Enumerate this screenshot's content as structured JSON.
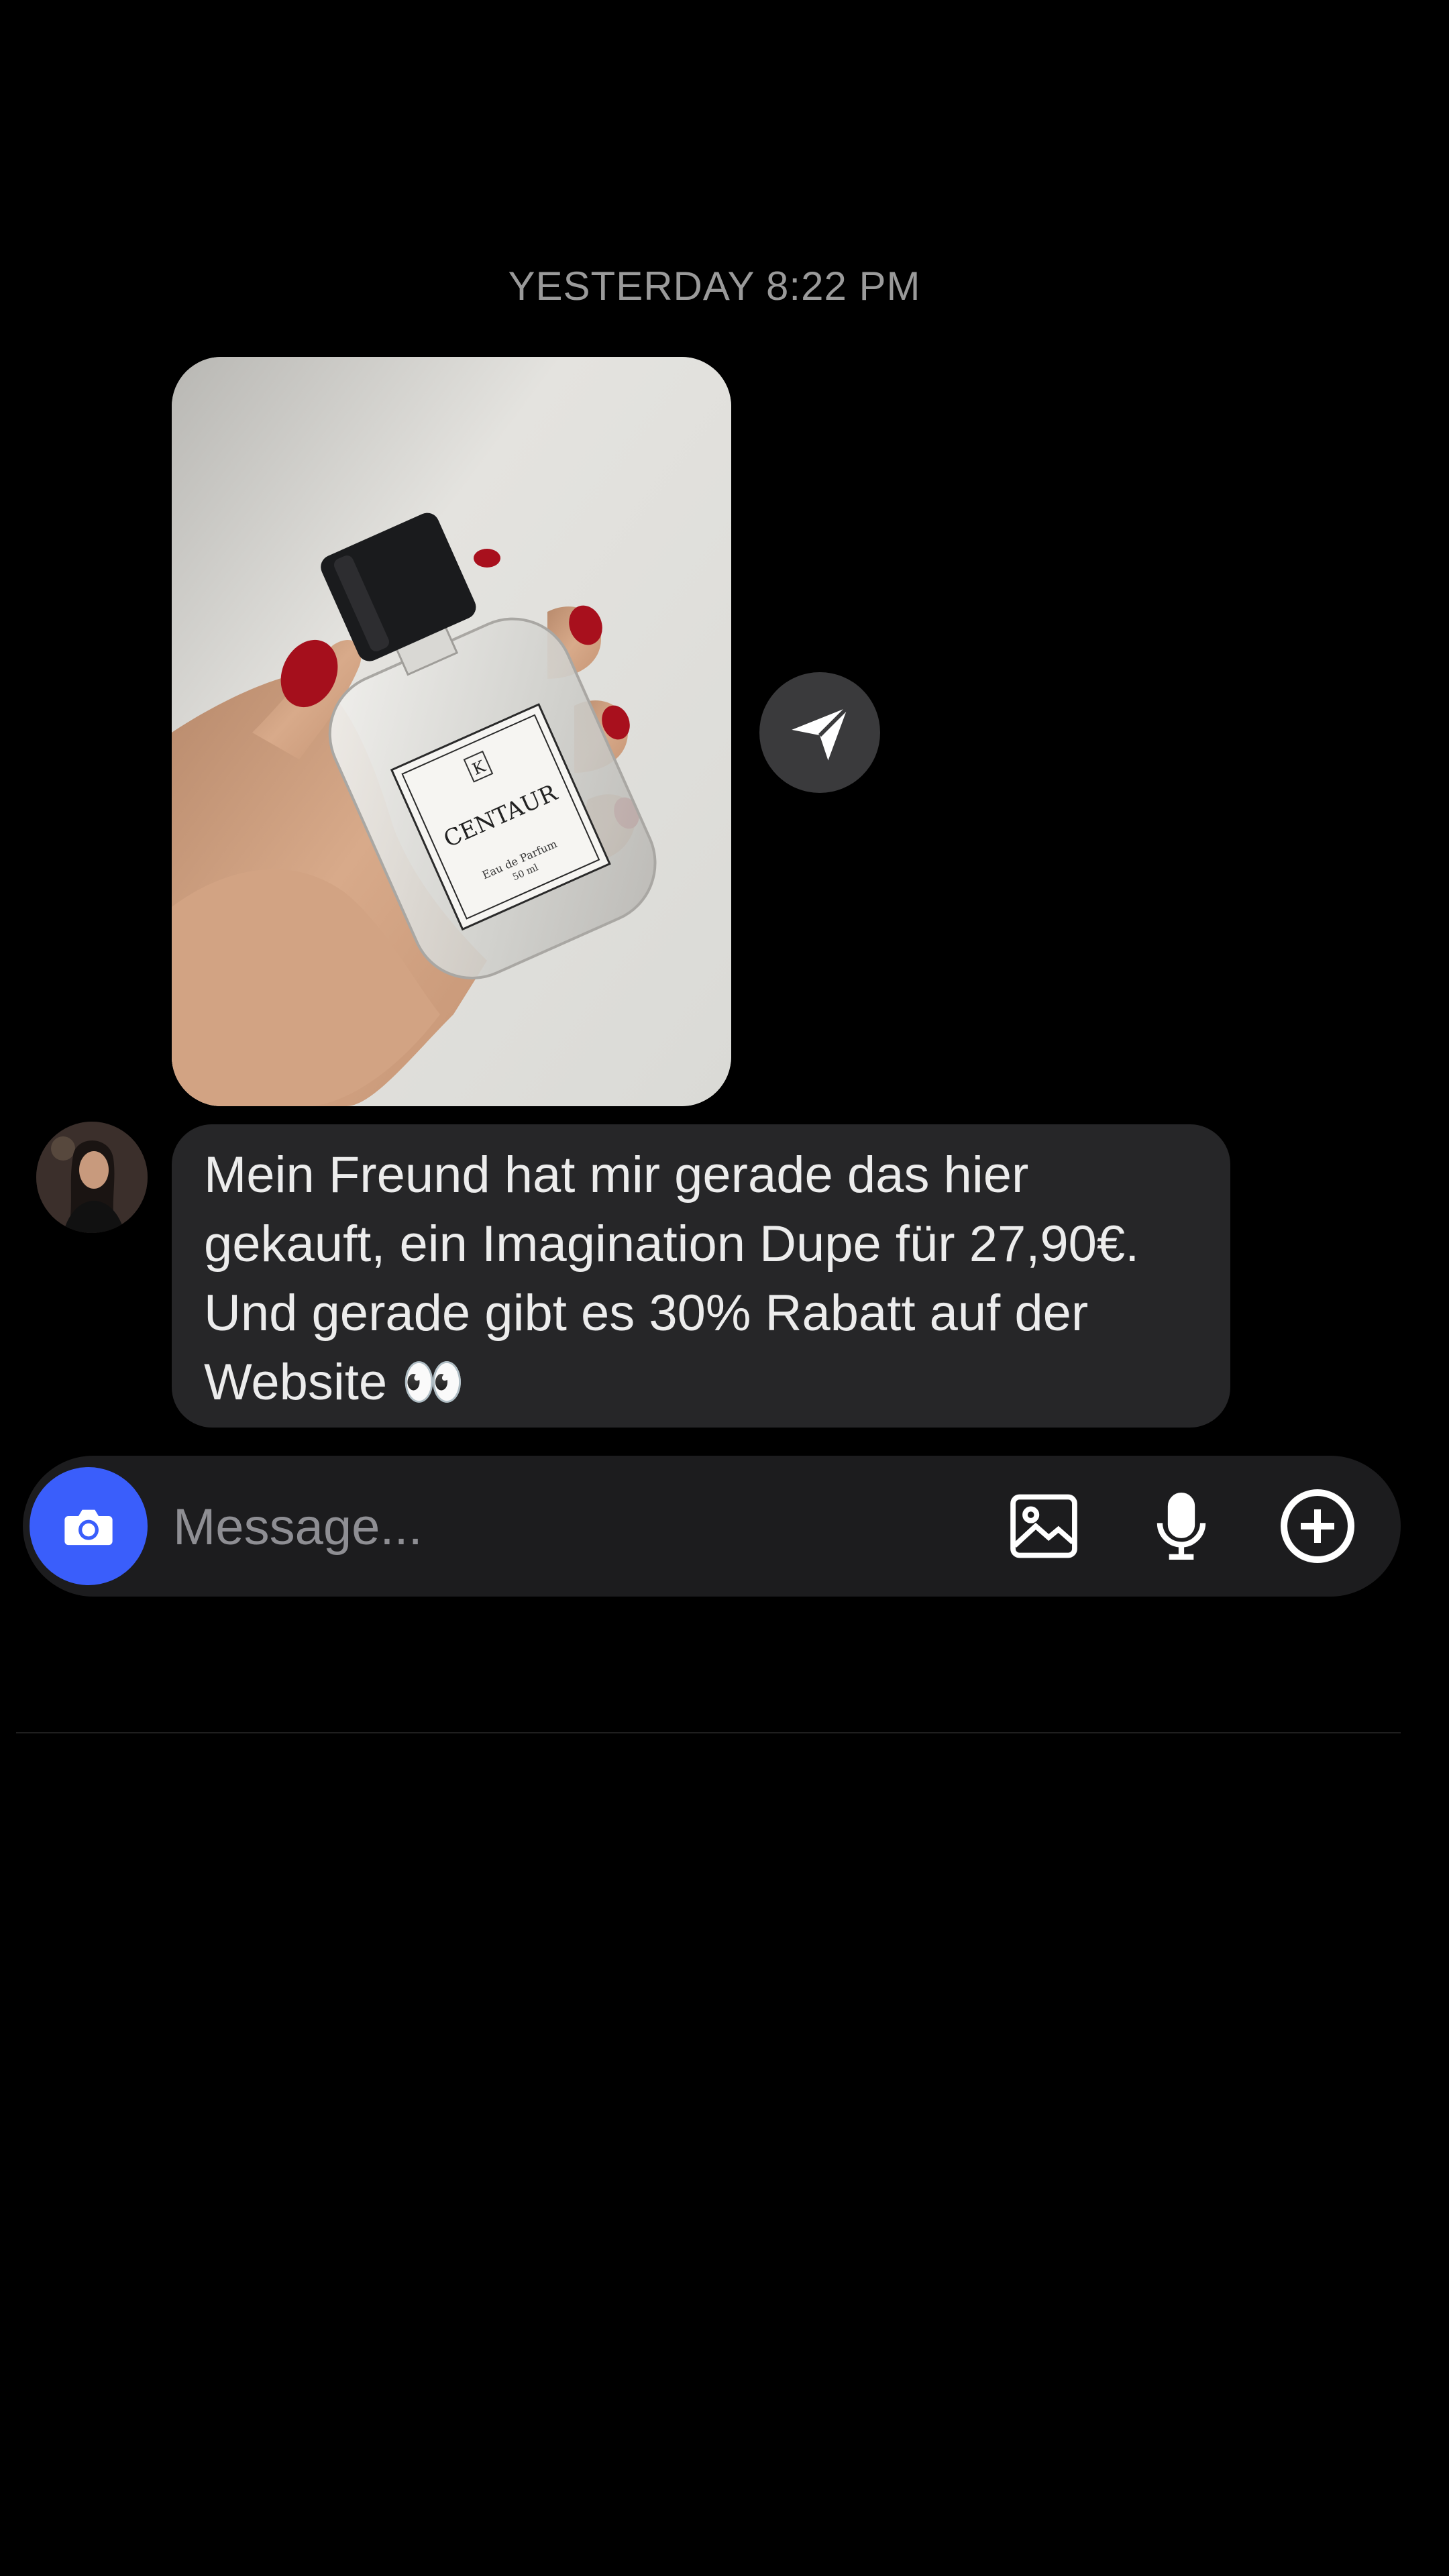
{
  "thread": {
    "timestamp": "YESTERDAY 8:22 PM",
    "photo_message": {
      "image": "perfume-bottle-photo",
      "bottle_label_logo": "K",
      "bottle_label_name": "CENTAUR",
      "bottle_label_line1": "Eau de Parfum",
      "bottle_label_line2": "50 ml"
    },
    "share_icon": "paper-plane-icon",
    "text_message": {
      "sender_avatar": "avatar-icon",
      "text": "Mein Freund hat mir gerade das hier\ngekauft, ein Imagination Dupe für 27,90€.\nUnd gerade gibt es 30% Rabatt auf der\nWebsite 👀"
    }
  },
  "composer": {
    "camera_icon": "camera-icon",
    "placeholder": "Message...",
    "gallery_icon": "image-icon",
    "mic_icon": "microphone-icon",
    "add_icon": "plus-circle-icon"
  },
  "colors": {
    "background": "#000000",
    "bubble": "#262628",
    "composer": "#1c1c1e",
    "camera_button": "#3a5efb",
    "timestamp": "#9a9a9a"
  }
}
